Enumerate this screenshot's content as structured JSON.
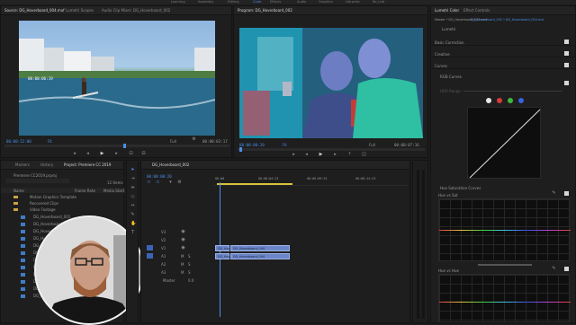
{
  "workspace_tabs": [
    "Learning",
    "Assembly",
    "Editing",
    "Color",
    "Effects",
    "Audio",
    "Graphics",
    "Libraries",
    "Re_hub"
  ],
  "source_panel": {
    "tabs": [
      "Source: DG_Hoverboard_004.mxf",
      "Lumetri Scopes",
      "Audio Clip Mixer: DG_Hoverboard_002"
    ],
    "timecode_left": "00:00:12:00",
    "fit": "Fit",
    "quality": "Full",
    "timecode_right": "00:00:03:17",
    "overlay_time": "00:00:06:19"
  },
  "program_panel": {
    "tabs": [
      "Program: DG_Hoverboard_002"
    ],
    "timecode_left": "00:00:00:20",
    "fit": "Fit",
    "quality": "Full",
    "timecode_right": "00:00:07:16"
  },
  "project_panel": {
    "tabs": [
      "Markers",
      "History",
      "Project: Premiere CC 2019"
    ],
    "project_file": "Premiere CC2019.prproj",
    "items_count": "12 Items",
    "columns": [
      "Name",
      "Frame Rate",
      "Media Start"
    ],
    "folders": [
      "Motion Graphics Template",
      "Recovered Clips",
      "Video Footage"
    ],
    "clips": [
      "DG_Hoverboard_001",
      "DG_Hoverboard_002",
      "DG_Hoverboard_003",
      "DG_Hoverboard_004",
      "DG_Hoverboard_005",
      "DG_Hoverboard_006",
      "DG_Hoverboard_007",
      "DG_Hoverboard_008",
      "DG_Hoverboard_009",
      "DG_Hoverboard_010",
      "DG_Hoverboard_011",
      "DG_Hoverboard_012"
    ]
  },
  "timeline_panel": {
    "tabs": [
      "DG_Hoverboard_002"
    ],
    "timecode": "00:00:00:20",
    "ruler": [
      "00:00",
      "00:00:04:23",
      "00:00:09:23",
      "00:00:14:23"
    ],
    "video_tracks": [
      "V3",
      "V2",
      "V1"
    ],
    "audio_tracks": [
      "A1",
      "A2",
      "A3"
    ],
    "master_label": "Master",
    "master_value": "0.0",
    "clips_v1": [
      "DG_Hoverb",
      "DG_Hoverboard_004"
    ],
    "clips_a1": [
      "DG_Hoverb",
      "DG_Hoverboard_004"
    ]
  },
  "lumetri": {
    "tabs": [
      "Lumetri Color",
      "Effect Controls"
    ],
    "master": "Master * DG_Hoverboard_002.mxf",
    "clip": "DG_Hoverboard_002 * DG_Hoverboard_004.mxf",
    "layer": "Lumetri",
    "sections": [
      "Basic Correction",
      "Creative",
      "Curves",
      "RGB Curves"
    ],
    "hdr_label": "HDR Range",
    "hue_saturation": "Hue Saturation Curves",
    "hue_vs_sat": "Hue vs Sat",
    "hue_vs_hue": "Hue vs Hue",
    "dot_colors": [
      "#e8e8e8",
      "#d83a3a",
      "#3fb83f",
      "#3a62e0"
    ]
  }
}
